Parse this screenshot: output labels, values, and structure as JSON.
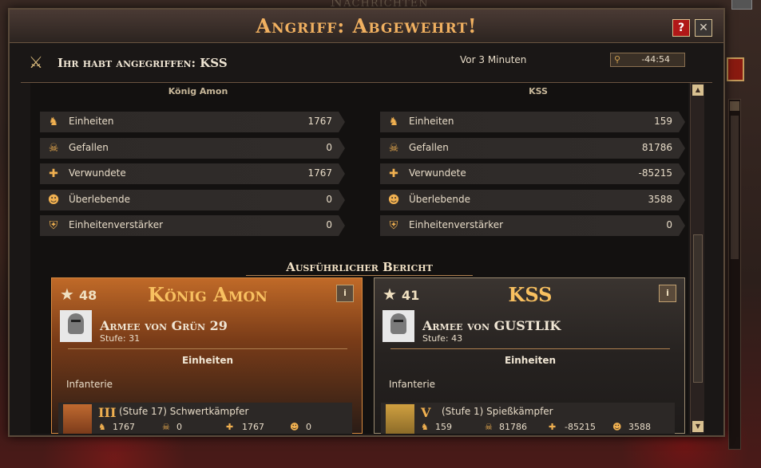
{
  "background": {
    "window_title": "Nachrichten"
  },
  "dialog": {
    "title": "Angriff: Abgewehrt!",
    "help_label": "?",
    "close_label": "✕",
    "attack_text": "Ihr habt angegriffen: KSS",
    "time": "Vor 3 Minuten",
    "coordinates": "-44:54"
  },
  "summary": {
    "left": {
      "name": "König Amon",
      "stats": [
        {
          "icon": "units-icon",
          "label": "Einheiten",
          "value": "1767"
        },
        {
          "icon": "skull-icon",
          "label": "Gefallen",
          "value": "0"
        },
        {
          "icon": "wounded-icon",
          "label": "Verwundete",
          "value": "1767"
        },
        {
          "icon": "survivor-icon",
          "label": "Überlebende",
          "value": "0"
        },
        {
          "icon": "armor-icon",
          "label": "Einheitenverstärker",
          "value": "0"
        }
      ]
    },
    "right": {
      "name": "KSS",
      "stats": [
        {
          "icon": "units-icon",
          "label": "Einheiten",
          "value": "159"
        },
        {
          "icon": "skull-icon",
          "label": "Gefallen",
          "value": "81786"
        },
        {
          "icon": "wounded-icon",
          "label": "Verwundete",
          "value": "-85215"
        },
        {
          "icon": "survivor-icon",
          "label": "Überlebende",
          "value": "3588"
        },
        {
          "icon": "armor-icon",
          "label": "Einheitenverstärker",
          "value": "0"
        }
      ]
    }
  },
  "detail": {
    "section_title": "Ausführlicher Bericht",
    "attacker": {
      "level": "48",
      "name": "König Amon",
      "info_label": "i",
      "army": "Armee von Grün 29",
      "stufe": "Stufe: 31",
      "units_heading": "Einheiten",
      "category": "Infanterie",
      "unit": {
        "rank": "III",
        "name": "(Stufe 17) Schwertkämpfer",
        "stats": [
          "1767",
          "0",
          "1767",
          "0"
        ]
      }
    },
    "defender": {
      "level": "41",
      "name": "KSS",
      "info_label": "i",
      "army": "Armee von GUSTLIK",
      "stufe": "Stufe: 43",
      "units_heading": "Einheiten",
      "category": "Infanterie",
      "unit": {
        "rank": "V",
        "name": "(Stufe 1) Spießkämpfer",
        "stats": [
          "159",
          "81786",
          "-85215",
          "3588"
        ]
      }
    }
  },
  "colors": {
    "title": "#f0b060",
    "attacker_card": "#c06a28",
    "defender_card": "#3a3430",
    "icon": "#f0b050"
  }
}
